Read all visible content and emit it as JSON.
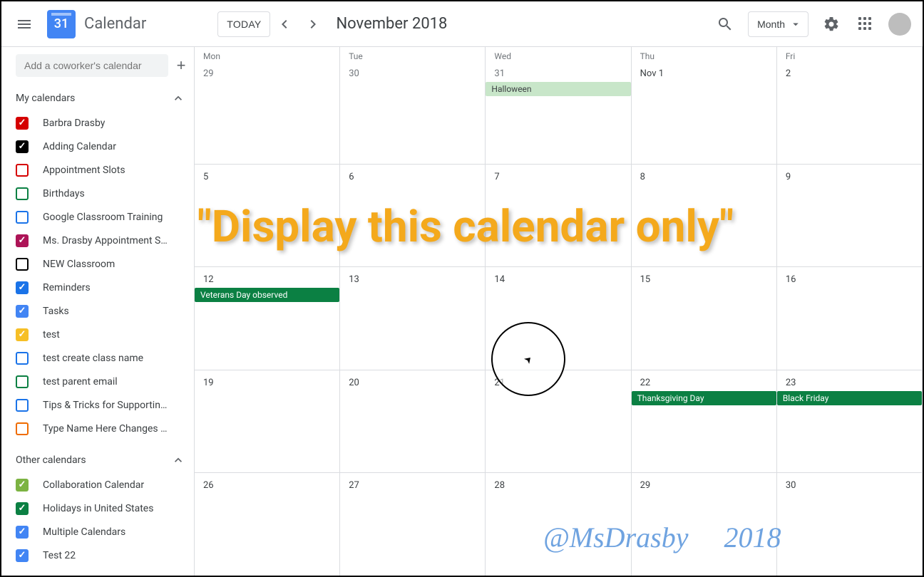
{
  "header": {
    "logo_day": "31",
    "app_title": "Calendar",
    "today_label": "TODAY",
    "date_label": "November 2018",
    "view_label": "Month"
  },
  "sidebar": {
    "add_coworker_placeholder": "Add a coworker's calendar",
    "my_calendars_label": "My calendars",
    "other_calendars_label": "Other calendars",
    "my_calendars": [
      {
        "label": "Barbra Drasby",
        "color": "#d50000",
        "checked": true
      },
      {
        "label": "Adding Calendar",
        "color": "#000000",
        "checked": true
      },
      {
        "label": "Appointment Slots",
        "color": "#d50000",
        "checked": false
      },
      {
        "label": "Birthdays",
        "color": "#0b8043",
        "checked": false
      },
      {
        "label": "Google Classroom Training",
        "color": "#1a73e8",
        "checked": false
      },
      {
        "label": "Ms. Drasby Appointment S…",
        "color": "#ad1457",
        "checked": true
      },
      {
        "label": "NEW Classroom",
        "color": "#000000",
        "checked": false
      },
      {
        "label": "Reminders",
        "color": "#1a73e8",
        "checked": true
      },
      {
        "label": "Tasks",
        "color": "#4285f4",
        "checked": true
      },
      {
        "label": "test",
        "color": "#f6bf26",
        "checked": true
      },
      {
        "label": "test create class name",
        "color": "#1a73e8",
        "checked": false
      },
      {
        "label": "test parent email",
        "color": "#0b8043",
        "checked": false
      },
      {
        "label": "Tips & Tricks for Supportin…",
        "color": "#1a73e8",
        "checked": false
      },
      {
        "label": "Type Name Here Changes …",
        "color": "#ef6c00",
        "checked": false
      }
    ],
    "other_calendars": [
      {
        "label": "Collaboration Calendar",
        "color": "#7cb342",
        "checked": true
      },
      {
        "label": "Holidays in United States",
        "color": "#0b8043",
        "checked": true
      },
      {
        "label": "Multiple Calendars",
        "color": "#4285f4",
        "checked": true
      },
      {
        "label": "Test 22",
        "color": "#4285f4",
        "checked": true
      }
    ]
  },
  "grid": {
    "weekdays": [
      "Mon",
      "Tue",
      "Wed",
      "Thu",
      "Fri"
    ],
    "weeks": [
      {
        "days": [
          {
            "num": "29",
            "other": true
          },
          {
            "num": "30",
            "other": true
          },
          {
            "num": "31",
            "other": true,
            "events": [
              {
                "label": "Halloween",
                "pale": true
              }
            ]
          },
          {
            "num": "Nov 1",
            "emph": true
          },
          {
            "num": "2"
          }
        ]
      },
      {
        "days": [
          {
            "num": "5"
          },
          {
            "num": "6"
          },
          {
            "num": "7"
          },
          {
            "num": "8"
          },
          {
            "num": "9"
          }
        ]
      },
      {
        "days": [
          {
            "num": "12",
            "events": [
              {
                "label": "Veterans Day observed"
              }
            ]
          },
          {
            "num": "13"
          },
          {
            "num": "14"
          },
          {
            "num": "15"
          },
          {
            "num": "16"
          }
        ]
      },
      {
        "days": [
          {
            "num": "19"
          },
          {
            "num": "20"
          },
          {
            "num": "21"
          },
          {
            "num": "22",
            "events": [
              {
                "label": "Thanksgiving Day"
              }
            ]
          },
          {
            "num": "23",
            "events": [
              {
                "label": "Black Friday"
              }
            ]
          }
        ]
      },
      {
        "days": [
          {
            "num": "26"
          },
          {
            "num": "27"
          },
          {
            "num": "28"
          },
          {
            "num": "29"
          },
          {
            "num": "30"
          }
        ]
      }
    ]
  },
  "overlay": {
    "headline": "\"Display this calendar only\"",
    "watermark_handle": "@MsDrasby",
    "watermark_year": "2018"
  }
}
